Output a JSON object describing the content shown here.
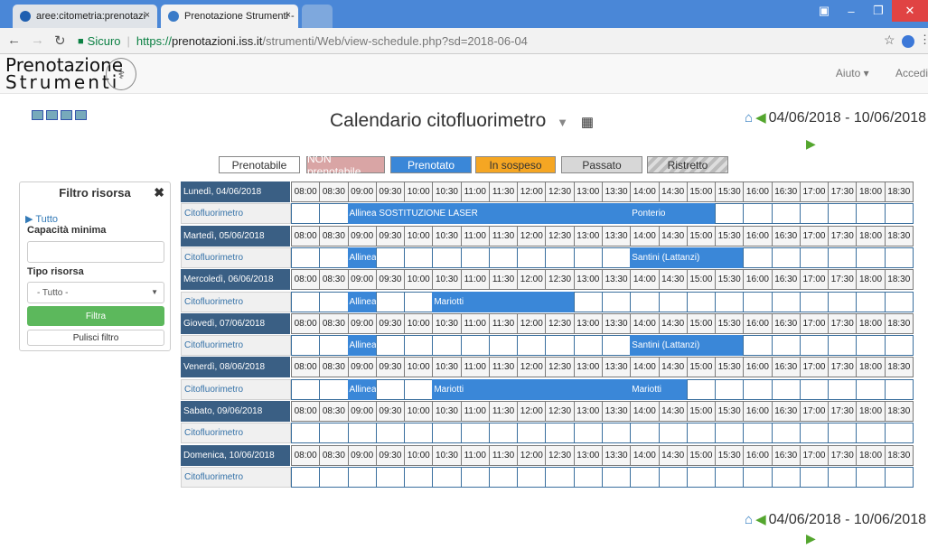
{
  "browser": {
    "tabs": [
      {
        "label": "aree:citometria:prenotazi",
        "close": "×"
      },
      {
        "label": "Prenotazione Strumenti -",
        "close": "×"
      }
    ],
    "url": {
      "secure": "Sicuro",
      "protocol": "https://",
      "host": "prenotazioni.iss.it",
      "path": "/strumenti/Web/view-schedule.php?sd=2018-06-04"
    }
  },
  "navbar": {
    "logo_line1": "Prenotazione",
    "logo_line2": "Strumenti",
    "help": "Aiuto ▾",
    "login": "Accedi"
  },
  "page_title": "Calendario citofluorimetro",
  "date_range": "04/06/2018 - 10/06/2018",
  "legend": [
    {
      "label": "Prenotabile",
      "bg": "#ffffff",
      "color": "#333333"
    },
    {
      "label": "NON prenotabile",
      "bg": "#d9a5a5",
      "color": "#ffffff"
    },
    {
      "label": "Prenotato",
      "bg": "#3a87d8",
      "color": "#ffffff"
    },
    {
      "label": "In sospeso",
      "bg": "#f5a623",
      "color": "#333333"
    },
    {
      "label": "Passato",
      "bg": "#d7d7d7",
      "color": "#333333"
    },
    {
      "label": "Ristretto",
      "bg": "#cfcfcf",
      "color": "#333333"
    }
  ],
  "filter": {
    "title": "Filtro risorsa",
    "all": "Tutto",
    "min_capacity": "Capacità minima",
    "resource_type": "Tipo risorsa",
    "type_selected": "- Tutto -",
    "filter_button": "Filtra",
    "clear_button": "Pulisci filtro"
  },
  "resource": "Citofluorimetro",
  "times": [
    "08:00",
    "08:30",
    "09:00",
    "09:30",
    "10:00",
    "10:30",
    "11:00",
    "11:30",
    "12:00",
    "12:30",
    "13:00",
    "13:30",
    "14:00",
    "14:30",
    "15:00",
    "15:30",
    "16:00",
    "16:30",
    "17:00",
    "17:30",
    "18:00",
    "18:30"
  ],
  "days": [
    {
      "label": "Lunedì, 04/06/2018",
      "reservations": [
        {
          "label": "Allinea SOSTITUZIONE LASER",
          "start": "09:00",
          "end": "14:00"
        },
        {
          "label": "Ponterio",
          "start": "14:00",
          "end": "15:30"
        }
      ]
    },
    {
      "label": "Martedì, 05/06/2018",
      "reservations": [
        {
          "label": "Allinea",
          "start": "09:00",
          "end": "09:30"
        },
        {
          "label": "Santini (Lattanzi)",
          "start": "14:00",
          "end": "16:00"
        }
      ]
    },
    {
      "label": "Mercoledì, 06/06/2018",
      "reservations": [
        {
          "label": "Allinea",
          "start": "09:00",
          "end": "09:30"
        },
        {
          "label": "Mariotti",
          "start": "10:30",
          "end": "13:00"
        }
      ]
    },
    {
      "label": "Giovedì, 07/06/2018",
      "reservations": [
        {
          "label": "Allinea",
          "start": "09:00",
          "end": "09:30"
        },
        {
          "label": "Santini (Lattanzi)",
          "start": "14:00",
          "end": "16:00"
        }
      ]
    },
    {
      "label": "Venerdì, 08/06/2018",
      "reservations": [
        {
          "label": "Allinea",
          "start": "09:00",
          "end": "09:30"
        },
        {
          "label": "Mariotti",
          "start": "10:30",
          "end": "14:00"
        },
        {
          "label": "Mariotti",
          "start": "14:00",
          "end": "15:00"
        }
      ]
    },
    {
      "label": "Sabato, 09/06/2018",
      "reservations": []
    },
    {
      "label": "Domenica, 10/06/2018",
      "reservations": []
    }
  ]
}
